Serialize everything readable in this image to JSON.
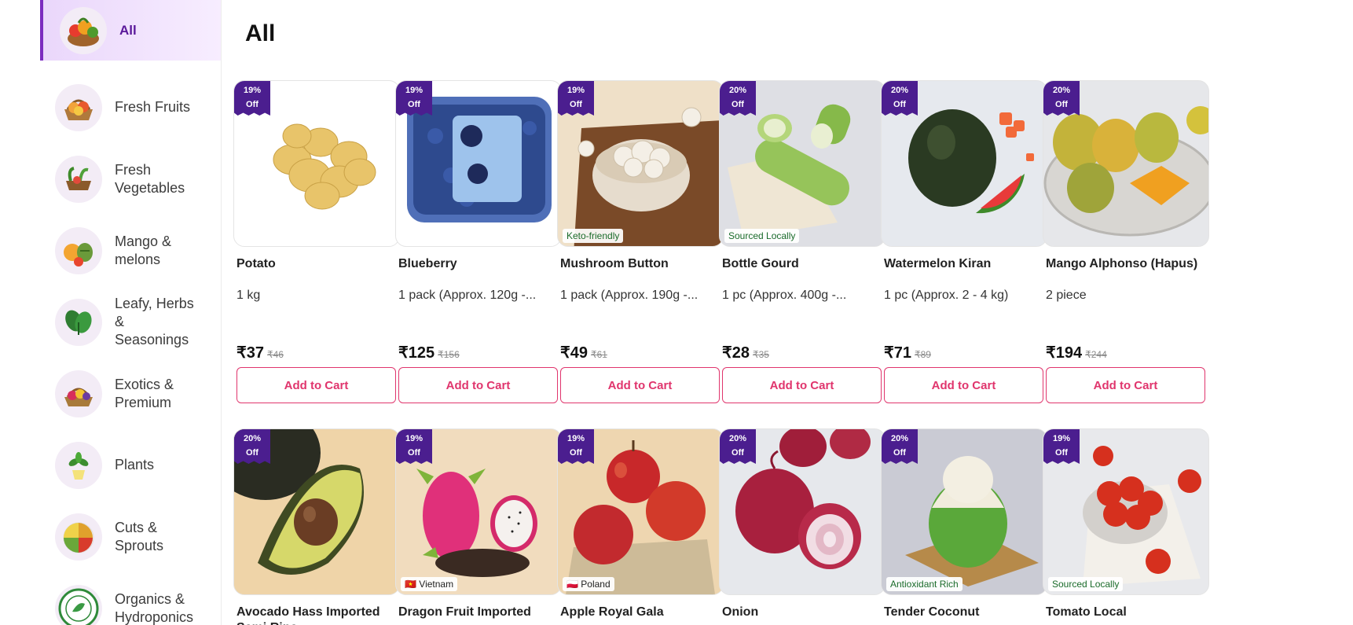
{
  "page_title": "All",
  "sidebar": {
    "items": [
      {
        "label": "All",
        "icon": "vegetable-basket-icon",
        "active": true
      },
      {
        "label": "Fresh Fruits",
        "icon": "fruit-basket-icon"
      },
      {
        "label": "Fresh Vegetables",
        "icon": "vegetables-icon"
      },
      {
        "label": "Mango & melons",
        "icon": "mango-melon-icon"
      },
      {
        "label": "Leafy, Herbs & Seasonings",
        "icon": "spinach-icon"
      },
      {
        "label": "Exotics & Premium",
        "icon": "exotic-basket-icon"
      },
      {
        "label": "Plants",
        "icon": "potted-plant-icon"
      },
      {
        "label": "Cuts & Sprouts",
        "icon": "sprouts-bowl-icon"
      },
      {
        "label": "Organics & Hydroponics",
        "icon": "organic-seal-icon"
      }
    ]
  },
  "products": [
    {
      "discount_pct": "19%",
      "discount_off": "Off",
      "name": "Potato",
      "qty": "1 kg",
      "price": "₹37",
      "mrp": "₹46",
      "button": "Add to Cart",
      "image": "potatoes"
    },
    {
      "discount_pct": "19%",
      "discount_off": "Off",
      "name": "Blueberry",
      "qty": "1 pack (Approx. 120g -...",
      "price": "₹125",
      "mrp": "₹156",
      "button": "Add to Cart",
      "image": "blueberry-pack"
    },
    {
      "discount_pct": "19%",
      "discount_off": "Off",
      "name": "Mushroom Button",
      "qty": "1 pack (Approx. 190g -...",
      "price": "₹49",
      "mrp": "₹61",
      "button": "Add to Cart",
      "tag": "Keto-friendly",
      "image": "mushrooms"
    },
    {
      "discount_pct": "20%",
      "discount_off": "Off",
      "name": "Bottle Gourd",
      "qty": "1 pc (Approx. 400g -...",
      "price": "₹28",
      "mrp": "₹35",
      "button": "Add to Cart",
      "tag": "Sourced Locally",
      "image": "bottle-gourd"
    },
    {
      "discount_pct": "20%",
      "discount_off": "Off",
      "name": "Watermelon Kiran",
      "qty": "1 pc (Approx. 2 - 4 kg)",
      "price": "₹71",
      "mrp": "₹89",
      "button": "Add to Cart",
      "image": "watermelon"
    },
    {
      "discount_pct": "20%",
      "discount_off": "Off",
      "name": "Mango Alphonso (Hapus)",
      "qty": "2 piece",
      "price": "₹194",
      "mrp": "₹244",
      "button": "Add to Cart",
      "image": "mangoes"
    },
    {
      "discount_pct": "20%",
      "discount_off": "Off",
      "name": "Avocado Hass Imported Semi Ripe",
      "image": "avocado"
    },
    {
      "discount_pct": "19%",
      "discount_off": "Off",
      "name": "Dragon Fruit Imported",
      "origin_tag": "🇻🇳 Vietnam",
      "image": "dragon-fruit"
    },
    {
      "discount_pct": "19%",
      "discount_off": "Off",
      "name": "Apple Royal Gala",
      "origin_tag": "🇵🇱 Poland",
      "image": "apples"
    },
    {
      "discount_pct": "20%",
      "discount_off": "Off",
      "name": "Onion",
      "image": "onions"
    },
    {
      "discount_pct": "20%",
      "discount_off": "Off",
      "name": "Tender Coconut",
      "tag": "Antioxidant Rich",
      "image": "coconut"
    },
    {
      "discount_pct": "19%",
      "discount_off": "Off",
      "name": "Tomato Local",
      "tag": "Sourced Locally",
      "image": "tomatoes"
    }
  ],
  "colors": {
    "accent": "#e0356d",
    "badge": "#4b1e8f",
    "active_category": "#5a189a"
  }
}
